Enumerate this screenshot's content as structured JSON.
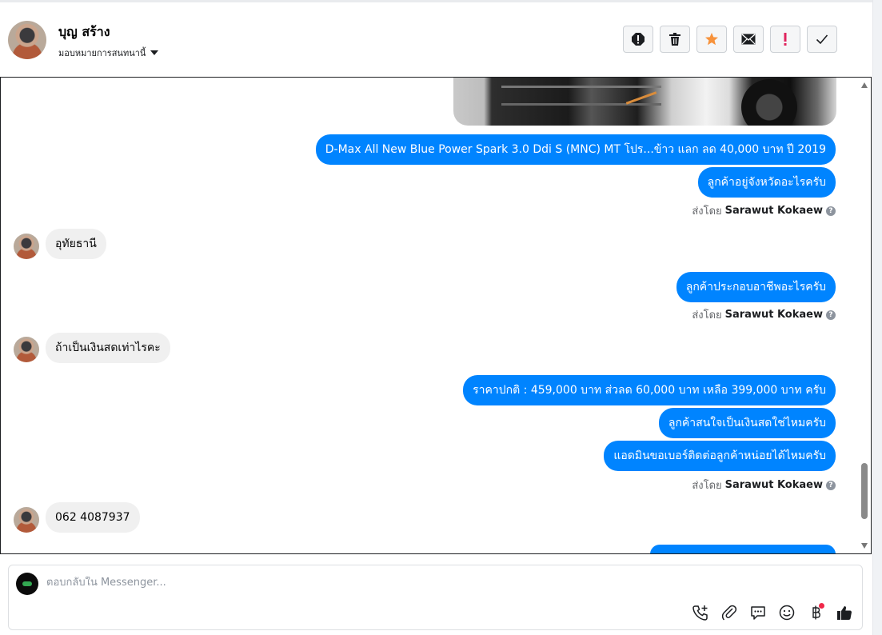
{
  "header": {
    "contact_name": "บุญ สร้าง",
    "assign_label": "มอบหมายการสนทนานี้",
    "actions": [
      {
        "name": "spam-icon-button",
        "title": "Spam"
      },
      {
        "name": "delete-button",
        "title": "Delete"
      },
      {
        "name": "star-button",
        "title": "Star"
      },
      {
        "name": "mark-unread-button",
        "title": "Unread"
      },
      {
        "name": "follow-up-button",
        "title": "Follow up"
      },
      {
        "name": "mark-done-button",
        "title": "Done"
      }
    ]
  },
  "colors": {
    "outgoing": "#0084ff",
    "incoming": "#f0f0f0",
    "star": "#f7923b",
    "badge": "#f02849"
  },
  "messages": {
    "out1": "D-Max All New Blue Power Spark 3.0 Ddi S (MNC) MT โปร...ข้าว แลก ลด 40,000 บาท ปี 2019",
    "out2": "ลูกค้าอยู่จังหวัดอะไรครับ",
    "sent_by_1_prefix": "ส่งโดย",
    "sent_by_1_name": "Sarawut Kokaew",
    "in1": "อุทัยธานี",
    "out3": "ลูกค้าประกอบอาชีพอะไรครับ",
    "sent_by_2_prefix": "ส่งโดย",
    "sent_by_2_name": "Sarawut Kokaew",
    "in2": "ถ้าเป็นเงินสดเท่าไรคะ",
    "out4": "ราคาปกติ : 459,000 บาท ส่วลด 60,000 บาท เหลือ 399,000 บาท ครับ",
    "out5": "ลูกค้าสนใจเป็นเงินสดใช่ไหมครับ",
    "out6": "แอดมินขอเบอร์ติดต่อลูกค้าหน่อยได้ไหมครับ",
    "sent_by_3_prefix": "ส่งโดย",
    "sent_by_3_name": "Sarawut Kokaew",
    "in3": "062 4087937"
  },
  "composer": {
    "placeholder": "ตอบกลับใน Messenger...",
    "tools": [
      "call-add-icon",
      "attachment-icon",
      "saved-replies-icon",
      "emoji-icon",
      "baht-payment-icon",
      "thumbs-up-icon"
    ]
  }
}
